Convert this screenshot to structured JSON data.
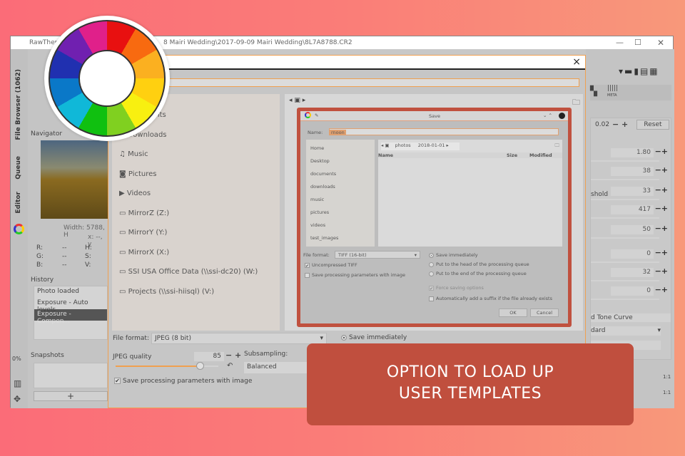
{
  "window": {
    "title_app": "RawTherap",
    "title_path": "8 Mairi Wedding\\2017-09-09 Mairi Wedding\\8L7A8788.CR2"
  },
  "side_tabs": {
    "file_browser": "File Browser (1062)",
    "queue": "Queue",
    "editor": "Editor"
  },
  "navigator": {
    "title": "Navigator",
    "width": "Width: 5788, H",
    "xy": "x: --, y",
    "r": "R:",
    "g": "G:",
    "b": "B:",
    "h": "H:",
    "s": "S:",
    "v": "V:",
    "dash": "--"
  },
  "history": {
    "title": "History",
    "items": [
      "Photo loaded",
      "Exposure - Auto levels",
      "Exposure - Compen..."
    ]
  },
  "snapshots": {
    "title": "Snapshots",
    "add": "+"
  },
  "zoom_pct": "0%",
  "export_dialog": {
    "places": [
      "Documents",
      "Downloads",
      "Music",
      "Pictures",
      "Videos",
      "MirrorZ (Z:)",
      "MirrorY (Y:)",
      "MirrorX (X:)",
      "SSI USA Office Data (\\\\ssi-dc20) (W:)",
      "Projects (\\\\ssi-hiisql) (V:)"
    ],
    "file_format_label": "File format:",
    "file_format": "JPEG (8 bit)",
    "jpeg_quality_label": "JPEG quality",
    "jpeg_quality": "85",
    "jpeg_quality_fraction": 0.82,
    "subsampling_label": "Subsampling:",
    "subsampling": "Balanced",
    "save_params": "Save processing parameters with image",
    "save_immediately": "Save immediately",
    "close": "×"
  },
  "save_dialog": {
    "title": "Save",
    "name_label": "Name:",
    "name_value": "rnoon",
    "path": [
      "photos",
      "2018-01-01"
    ],
    "places": [
      "Home",
      "Desktop",
      "documents",
      "downloads",
      "music",
      "pictures",
      "videos",
      "test_images"
    ],
    "columns": [
      "Name",
      "Size",
      "Modified"
    ],
    "file_format_label": "File format:",
    "file_format": "TIFF (16-bit)",
    "uncompressed": "Uncompressed TIFF",
    "save_params": "Save processing parameters with image",
    "options": [
      "Save immediately",
      "Put to the head of the processing queue",
      "Put to the end of the processing queue"
    ],
    "force": "Force saving options",
    "suffix": "Automatically add a suffix if the file already exists",
    "ok": "OK",
    "cancel": "Cancel"
  },
  "right_panel": {
    "top_value": "0.02",
    "reset": "Reset",
    "meta": "META",
    "values": [
      "1.80",
      "38",
      "33",
      "417",
      "50",
      "0",
      "32",
      "0"
    ],
    "threshold_label": "shold",
    "tone_curve": "d Tone Curve",
    "standard": "dard",
    "ratio": "1:1"
  },
  "callout": {
    "line1": "OPTION TO LOAD UP",
    "line2": "USER TEMPLATES"
  },
  "colors": {
    "callout": "#c04f3e",
    "accent": "#f0a050"
  }
}
